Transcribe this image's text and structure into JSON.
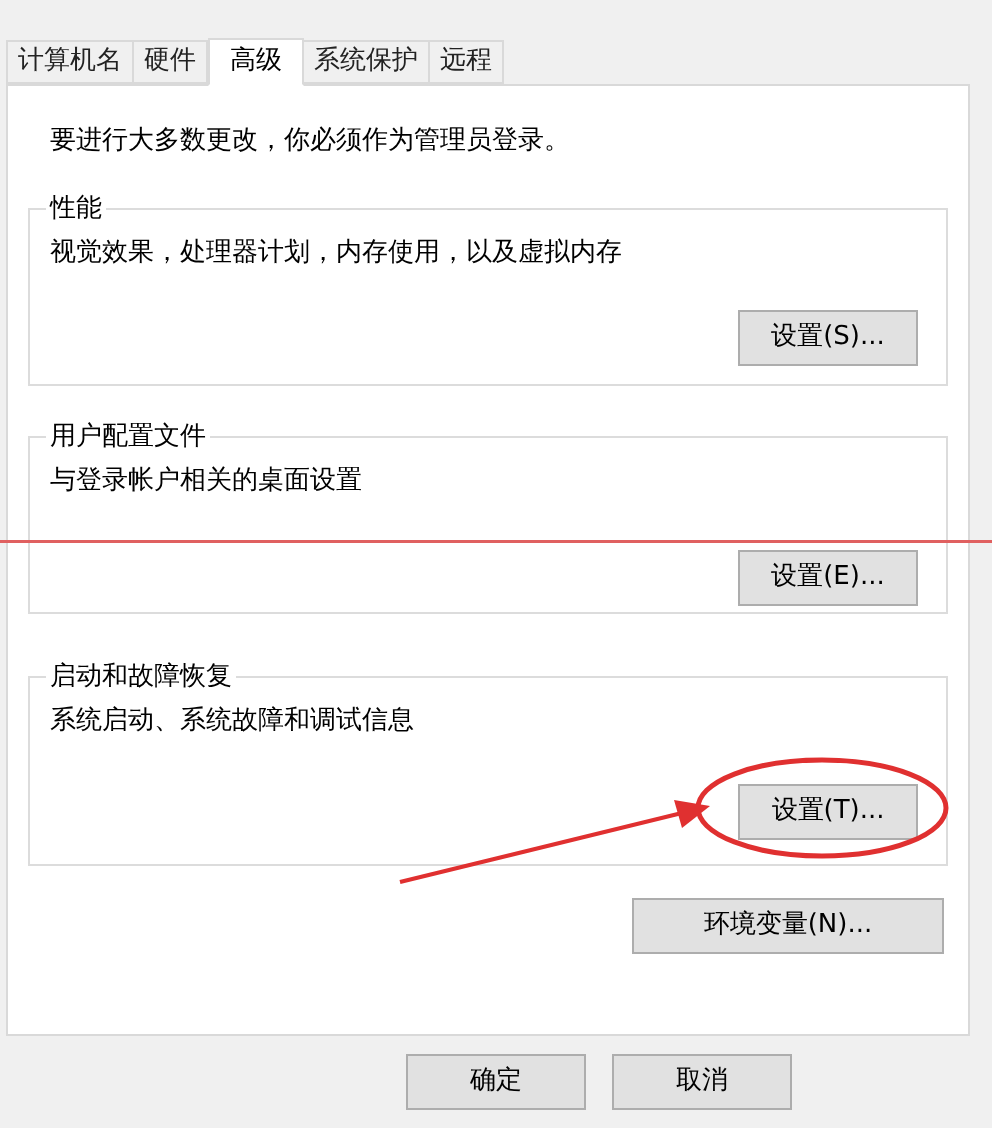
{
  "tabs": [
    {
      "label": "计算机名",
      "selected": false
    },
    {
      "label": "硬件",
      "selected": false
    },
    {
      "label": "高级",
      "selected": true
    },
    {
      "label": "系统保护",
      "selected": false
    },
    {
      "label": "远程",
      "selected": false
    }
  ],
  "notice": "要进行大多数更改，你必须作为管理员登录。",
  "groups": [
    {
      "title": "性能",
      "description": "视觉效果，处理器计划，内存使用，以及虚拟内存",
      "button": "设置(S)..."
    },
    {
      "title": "用户配置文件",
      "description": "与登录帐户相关的桌面设置",
      "button": "设置(E)..."
    },
    {
      "title": "启动和故障恢复",
      "description": "系统启动、系统故障和调试信息",
      "button": "设置(T)..."
    }
  ],
  "env_button": "环境变量(N)...",
  "dialog_buttons": [
    "确定",
    "取消"
  ]
}
